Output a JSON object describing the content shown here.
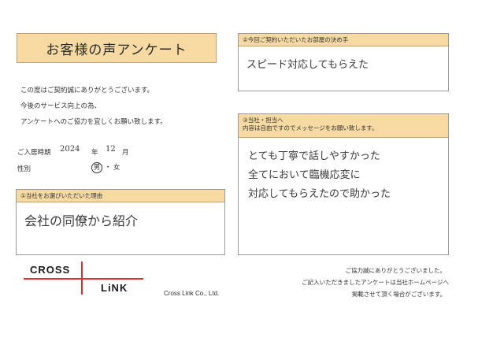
{
  "title": "お客様の声アンケート",
  "intro": [
    "この度はご契約誠にありがとうございます。",
    "今後のサービス向上の為、",
    "アンケートへのご協力を宜しくお願い致します。"
  ],
  "contract_date": {
    "label": "ご入居時期",
    "year": "2024",
    "year_unit": "年",
    "month": "12",
    "month_unit": "月"
  },
  "gender": {
    "label": "性別",
    "male": "男",
    "separator": "・",
    "female": "女",
    "selected": "男"
  },
  "q1": {
    "heading": "①当社をお選びいただいた理由",
    "answer": "会社の同僚から紹介"
  },
  "q2": {
    "heading": "②今回ご契約いただいたお部屋の決め手",
    "answer": "スピード対応してもらえた"
  },
  "q3": {
    "heading_lines": [
      "③当社・担当へ",
      "内容は自由ですのでメッセージをお願い致します。"
    ],
    "answer_lines": [
      "とても丁寧で話しやすかった",
      "全てにおいて臨機応変に",
      "対応してもらえたので助かった"
    ]
  },
  "logo": {
    "top": "CROSS",
    "bottom": "LiNK",
    "company": "Cross Link Co., Ltd.",
    "line_color": "#e0312d"
  },
  "footer": [
    "ご協力誠にありがとうございました。",
    "ご記入いただきましたアンケートは当社ホームページへ",
    "掲載させて頂く場合がございます。"
  ]
}
